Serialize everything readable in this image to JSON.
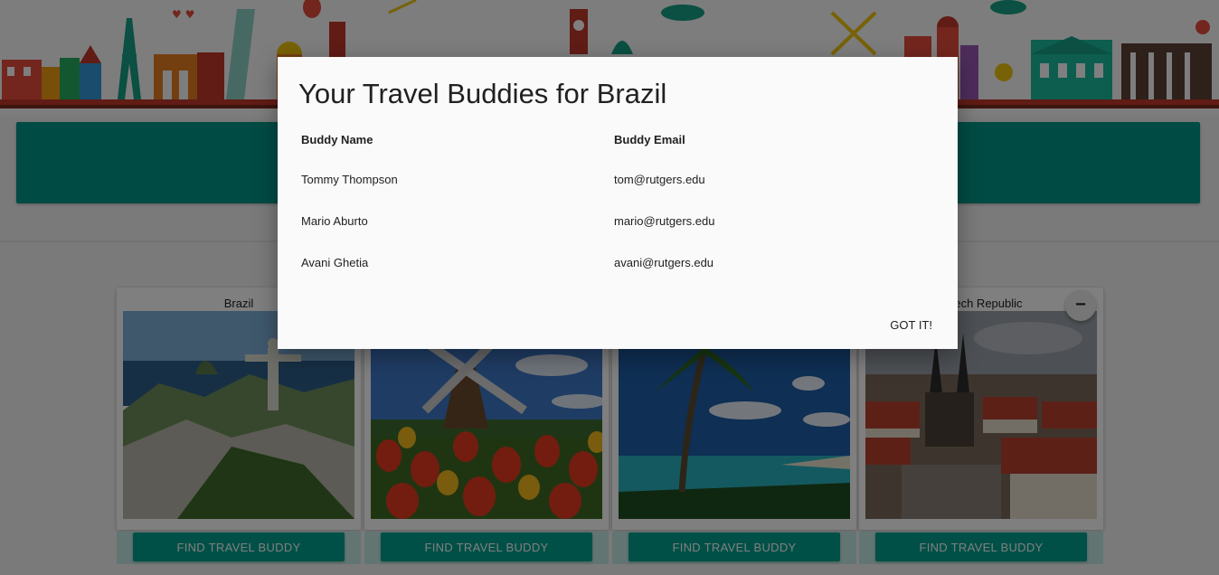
{
  "modal": {
    "title": "Your Travel Buddies for Brazil",
    "columns": [
      "Buddy Name",
      "Buddy Email"
    ],
    "rows": [
      {
        "name": "Tommy Thompson",
        "email": "tom@rutgers.edu"
      },
      {
        "name": "Mario Aburto",
        "email": "mario@rutgers.edu"
      },
      {
        "name": "Avani Ghetia",
        "email": "avani@rutgers.edu"
      }
    ],
    "confirm_label": "GOT IT!"
  },
  "cards": [
    {
      "country": "Brazil",
      "button_label": "FIND TRAVEL BUDDY",
      "image": "rio-christ-redeemer"
    },
    {
      "country": "",
      "button_label": "FIND TRAVEL BUDDY",
      "image": "windmill-tulips"
    },
    {
      "country": "",
      "button_label": "FIND TRAVEL BUDDY",
      "image": "palm-beach"
    },
    {
      "country": "Czech Republic",
      "visible_country_text": "ech Republic",
      "button_label": "FIND TRAVEL BUDDY",
      "image": "prague-old-town"
    }
  ],
  "fab": {
    "icon": "minus-icon",
    "glyph": "−"
  },
  "colors": {
    "primary": "#009688",
    "button": "#00a08e",
    "overlay": "rgba(0,0,0,0.5)",
    "modal_bg": "#fafafa"
  }
}
